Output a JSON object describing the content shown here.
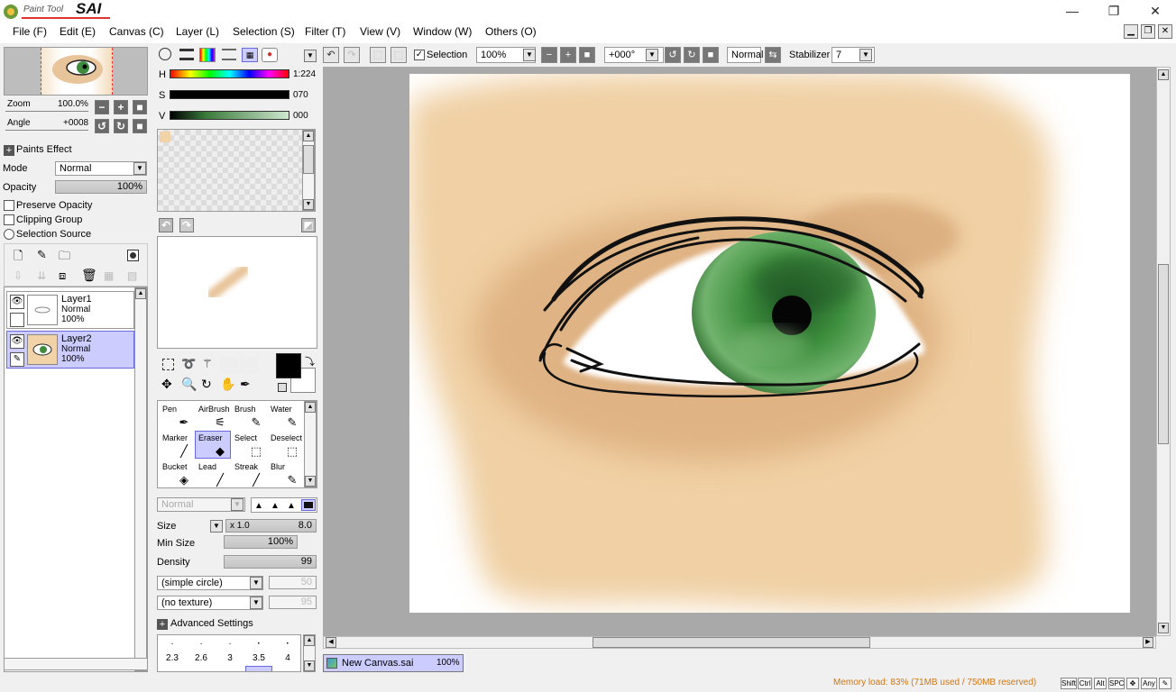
{
  "app": {
    "logo_small": "Paint Tool",
    "logo_big": "SAI"
  },
  "window": {
    "minimize": "—",
    "restore": "❐",
    "close": "✕"
  },
  "menu": [
    "File (F)",
    "Edit (E)",
    "Canvas (C)",
    "Layer (L)",
    "Selection (S)",
    "Filter (T)",
    "View (V)",
    "Window (W)",
    "Others (O)"
  ],
  "navigator": {
    "zoom_label": "Zoom",
    "zoom_value": "100.0%",
    "angle_label": "Angle",
    "angle_value": "+0008"
  },
  "paints_effect": {
    "title": "Paints Effect",
    "mode_label": "Mode",
    "mode_value": "Normal",
    "opacity_label": "Opacity",
    "opacity_value": "100%"
  },
  "options": {
    "preserve_opacity": "Preserve Opacity",
    "clipping_group": "Clipping Group",
    "selection_source": "Selection Source"
  },
  "layers": [
    {
      "name": "Layer1",
      "mode": "Normal",
      "opacity": "100%",
      "selected": false
    },
    {
      "name": "Layer2",
      "mode": "Normal",
      "opacity": "100%",
      "selected": true
    }
  ],
  "color": {
    "h_label": "H",
    "h_value": "1:224",
    "s_label": "S",
    "s_value": "070",
    "v_label": "V",
    "v_value": "000",
    "primary": "#000000",
    "secondary": "#ffffff",
    "swatch": "#f2d3a8"
  },
  "tools": [
    {
      "name": "Pen",
      "icon": "pen-icon",
      "glyph": "✒"
    },
    {
      "name": "AirBrush",
      "icon": "airbrush-icon",
      "glyph": "⚟"
    },
    {
      "name": "Brush",
      "icon": "brush-icon",
      "glyph": "🖌"
    },
    {
      "name": "Water",
      "icon": "water-icon",
      "glyph": "💧"
    },
    {
      "name": "Marker",
      "icon": "marker-icon",
      "glyph": "╱"
    },
    {
      "name": "Eraser",
      "icon": "eraser-icon",
      "glyph": "◆"
    },
    {
      "name": "Select",
      "icon": "select-brush-icon",
      "glyph": "⬚"
    },
    {
      "name": "Deselect",
      "icon": "deselect-brush-icon",
      "glyph": "⬚"
    },
    {
      "name": "Bucket",
      "icon": "bucket-icon",
      "glyph": "◈"
    },
    {
      "name": "Lead",
      "icon": "lead-icon",
      "glyph": "╱"
    },
    {
      "name": "Streak",
      "icon": "streak-icon",
      "glyph": "╱"
    },
    {
      "name": "Blur",
      "icon": "blur-icon",
      "glyph": "💧"
    }
  ],
  "brush": {
    "blend": "Normal",
    "size_label": "Size",
    "size_mult": "x 1.0",
    "size_value": "8.0",
    "minsize_label": "Min Size",
    "minsize_value": "100%",
    "density_label": "Density",
    "density_value": "99",
    "shape": "(simple circle)",
    "shape_value": "50",
    "texture": "(no texture)",
    "texture_value": "95",
    "advanced": "Advanced Settings"
  },
  "brush_sizes": [
    "2.3",
    "2.6",
    "3",
    "3.5",
    "4"
  ],
  "toolbar": {
    "selection_label": "Selection",
    "zoom": "100%",
    "rotation": "+000°",
    "blend": "Normal",
    "stabilizer_label": "Stabilizer",
    "stabilizer_value": "7"
  },
  "document": {
    "name": "New Canvas.sai",
    "zoom": "100%"
  },
  "status": {
    "memory": "Memory load: 83% (71MB used / 750MB reserved)",
    "keys": [
      "Shift",
      "Ctrl",
      "Alt",
      "SPC",
      "✥",
      "Any",
      "✎"
    ]
  }
}
